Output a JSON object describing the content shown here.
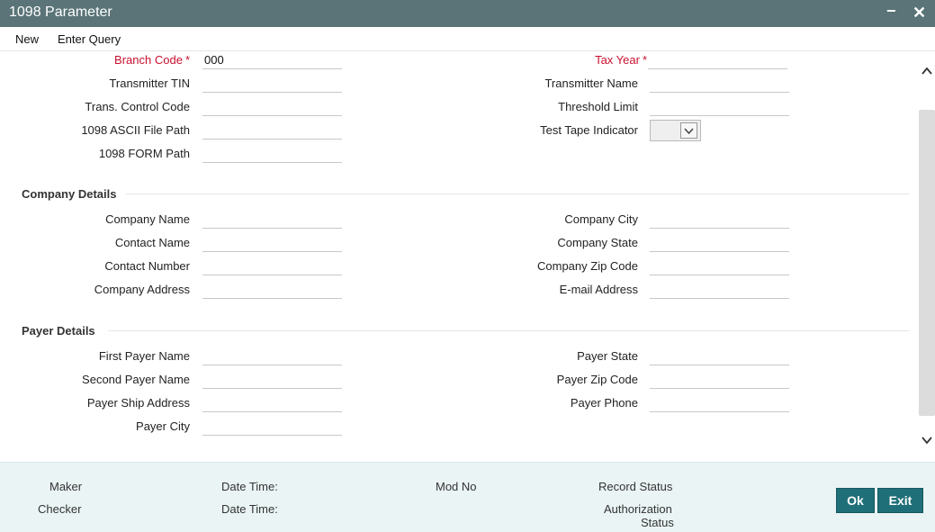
{
  "window": {
    "title": "1098 Parameter",
    "minimize_symbol": "−",
    "close_symbol": "✕"
  },
  "menu": {
    "new": "New",
    "enter_query": "Enter Query"
  },
  "fields": {
    "branch_code": {
      "label": "Branch Code",
      "value": "000",
      "required": "*"
    },
    "tax_year": {
      "label": "Tax Year",
      "value": "",
      "required": "*"
    },
    "transmitter_tin": {
      "label": "Transmitter TIN",
      "value": ""
    },
    "transmitter_name": {
      "label": "Transmitter Name",
      "value": ""
    },
    "trans_control_code": {
      "label": "Trans. Control Code",
      "value": ""
    },
    "threshold_limit": {
      "label": "Threshold Limit",
      "value": ""
    },
    "ascii_file_path": {
      "label": "1098 ASCII File Path",
      "value": ""
    },
    "test_tape_indicator": {
      "label": "Test Tape Indicator",
      "value": ""
    },
    "form_path": {
      "label": "1098 FORM Path",
      "value": ""
    }
  },
  "company": {
    "heading": "Company Details",
    "company_name": "Company Name",
    "contact_name": "Contact Name",
    "contact_number": "Contact Number",
    "company_address": "Company Address",
    "company_city": "Company City",
    "company_state": "Company State",
    "company_zip": "Company Zip Code",
    "email": "E-mail Address"
  },
  "payer": {
    "heading": "Payer Details",
    "first_payer_name": "First Payer Name",
    "second_payer_name": "Second Payer Name",
    "payer_ship_address": "Payer Ship Address",
    "payer_city": "Payer City",
    "payer_state": "Payer State",
    "payer_zip": "Payer Zip Code",
    "payer_phone": "Payer Phone"
  },
  "footer": {
    "maker": "Maker",
    "checker": "Checker",
    "date_time_1": "Date Time:",
    "date_time_2": "Date Time:",
    "mod_no": "Mod No",
    "record_status": "Record Status",
    "authorization_status_line1": "Authorization",
    "authorization_status_line2": "Status",
    "ok": "Ok",
    "exit": "Exit"
  },
  "colors": {
    "titlebar": "#5a7478",
    "required": "#c8102e",
    "button": "#1f6f78",
    "footer_bg": "#eaf4f4"
  }
}
